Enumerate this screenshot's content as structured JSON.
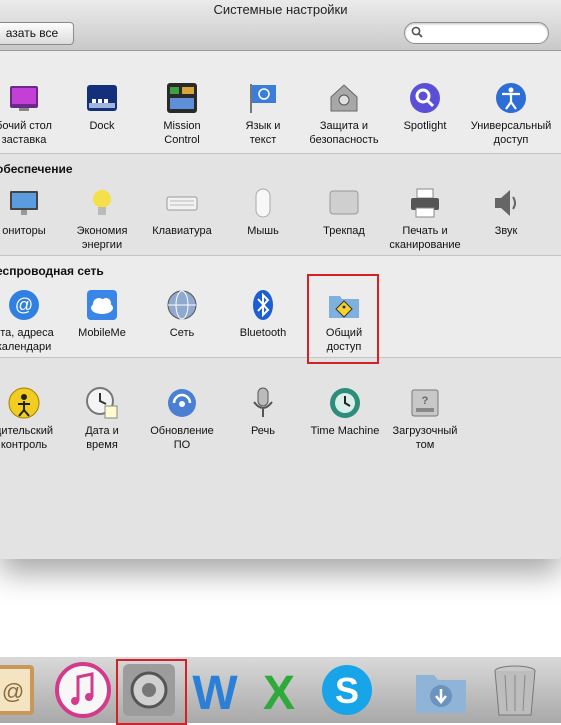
{
  "window": {
    "title": "Системные настройки"
  },
  "toolbar": {
    "show_all_label": "азать все",
    "search_value": ""
  },
  "sections": [
    {
      "title": "",
      "items": [
        {
          "id": "desktop",
          "label": "бочий стол\nзаставка",
          "icon": "desktop-icon"
        },
        {
          "id": "dock",
          "label": "Dock",
          "icon": "dock-icon"
        },
        {
          "id": "mission",
          "label": "Mission\nControl",
          "icon": "mission-control-icon"
        },
        {
          "id": "language",
          "label": "Язык и\nтекст",
          "icon": "language-flag-icon"
        },
        {
          "id": "security",
          "label": "Защита и\nбезопасность",
          "icon": "house-lock-icon"
        },
        {
          "id": "spotlight",
          "label": "Spotlight",
          "icon": "spotlight-icon"
        },
        {
          "id": "access",
          "label": "Универсальный\nдоступ",
          "icon": "accessibility-icon"
        }
      ]
    },
    {
      "title": "обеспечение",
      "items": [
        {
          "id": "monitors",
          "label": "ониторы",
          "icon": "monitor-icon"
        },
        {
          "id": "energy",
          "label": "Экономия\nэнергии",
          "icon": "bulb-icon"
        },
        {
          "id": "keyboard",
          "label": "Клавиатура",
          "icon": "keyboard-icon"
        },
        {
          "id": "mouse",
          "label": "Мышь",
          "icon": "mouse-icon"
        },
        {
          "id": "trackpad",
          "label": "Трекпад",
          "icon": "trackpad-icon"
        },
        {
          "id": "print",
          "label": "Печать и\nсканирование",
          "icon": "printer-icon"
        },
        {
          "id": "sound",
          "label": "Звук",
          "icon": "speaker-icon"
        }
      ]
    },
    {
      "title": "еспроводная сеть",
      "items": [
        {
          "id": "mail",
          "label": "нта, адреса\nкалендари",
          "icon": "at-sign-icon"
        },
        {
          "id": "mobileme",
          "label": "MobileMe",
          "icon": "cloud-icon"
        },
        {
          "id": "network",
          "label": "Сеть",
          "icon": "globe-icon"
        },
        {
          "id": "bluetooth",
          "label": "Bluetooth",
          "icon": "bluetooth-icon"
        },
        {
          "id": "sharing",
          "label": "Общий\nдоступ",
          "icon": "shared-folder-icon"
        }
      ]
    },
    {
      "title": "",
      "items": [
        {
          "id": "parental",
          "label": "дительский\nконтроль",
          "icon": "parental-icon"
        },
        {
          "id": "datetime",
          "label": "Дата и\nвремя",
          "icon": "clock-icon"
        },
        {
          "id": "update",
          "label": "Обновление\nПО",
          "icon": "software-update-icon"
        },
        {
          "id": "speech",
          "label": "Речь",
          "icon": "microphone-icon"
        },
        {
          "id": "timemachine",
          "label": "Time Machine",
          "icon": "time-machine-icon"
        },
        {
          "id": "startup",
          "label": "Загрузочный\nтом",
          "icon": "hard-drive-icon"
        }
      ]
    }
  ],
  "dock": [
    "address-book-icon",
    "itunes-icon",
    "system-preferences-icon",
    "word-icon",
    "excel-icon",
    "skype-icon",
    "downloads-icon",
    "trash-icon"
  ],
  "colors": {
    "highlight": "#d62027",
    "window_bg": "#ececec"
  }
}
